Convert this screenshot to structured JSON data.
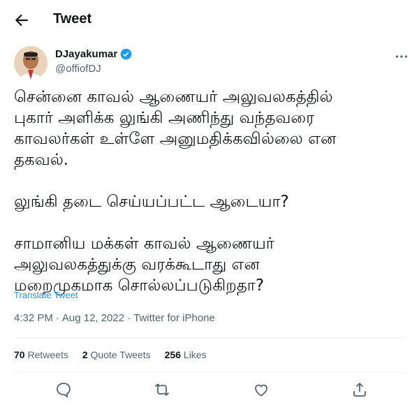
{
  "header": {
    "title": "Tweet"
  },
  "author": {
    "name": "DJayakumar",
    "handle": "@offiofDJ"
  },
  "tweet": {
    "paragraphs": [
      "சென்னை காவல் ஆணையர் அலுவலகத்தில்\nபுகார் அளிக்க லுங்கி அணிந்து வந்தவரை\nகாவலர்கள் உள்ளே அனுமதிக்கவில்லை என\nதகவல்.",
      "லுங்கி தடை செய்யப்பட்ட ஆடையா?",
      "சாமானிய மக்கள் காவல் ஆணையர்\nஅலுவலகத்துக்கு வரக்கூடாது என\nமறைமுகமாக சொல்லப்படுகிறதா?"
    ],
    "translate_label": "Translate Tweet",
    "time": "4:32 PM",
    "date": "Aug 12, 2022",
    "source": "Twitter for iPhone",
    "dot": "·"
  },
  "stats": {
    "retweets_count": "70",
    "retweets_label": "Retweets",
    "quote_count": "2",
    "quote_label": "Quote Tweets",
    "likes_count": "256",
    "likes_label": "Likes"
  },
  "colors": {
    "accent": "#1d9bf0",
    "text": "#0f1419",
    "muted": "#536471",
    "divider": "#eff3f4"
  },
  "icons": [
    "back-arrow-icon",
    "verified-badge-icon",
    "more-icon",
    "reply-icon",
    "retweet-icon",
    "like-icon",
    "share-icon"
  ]
}
